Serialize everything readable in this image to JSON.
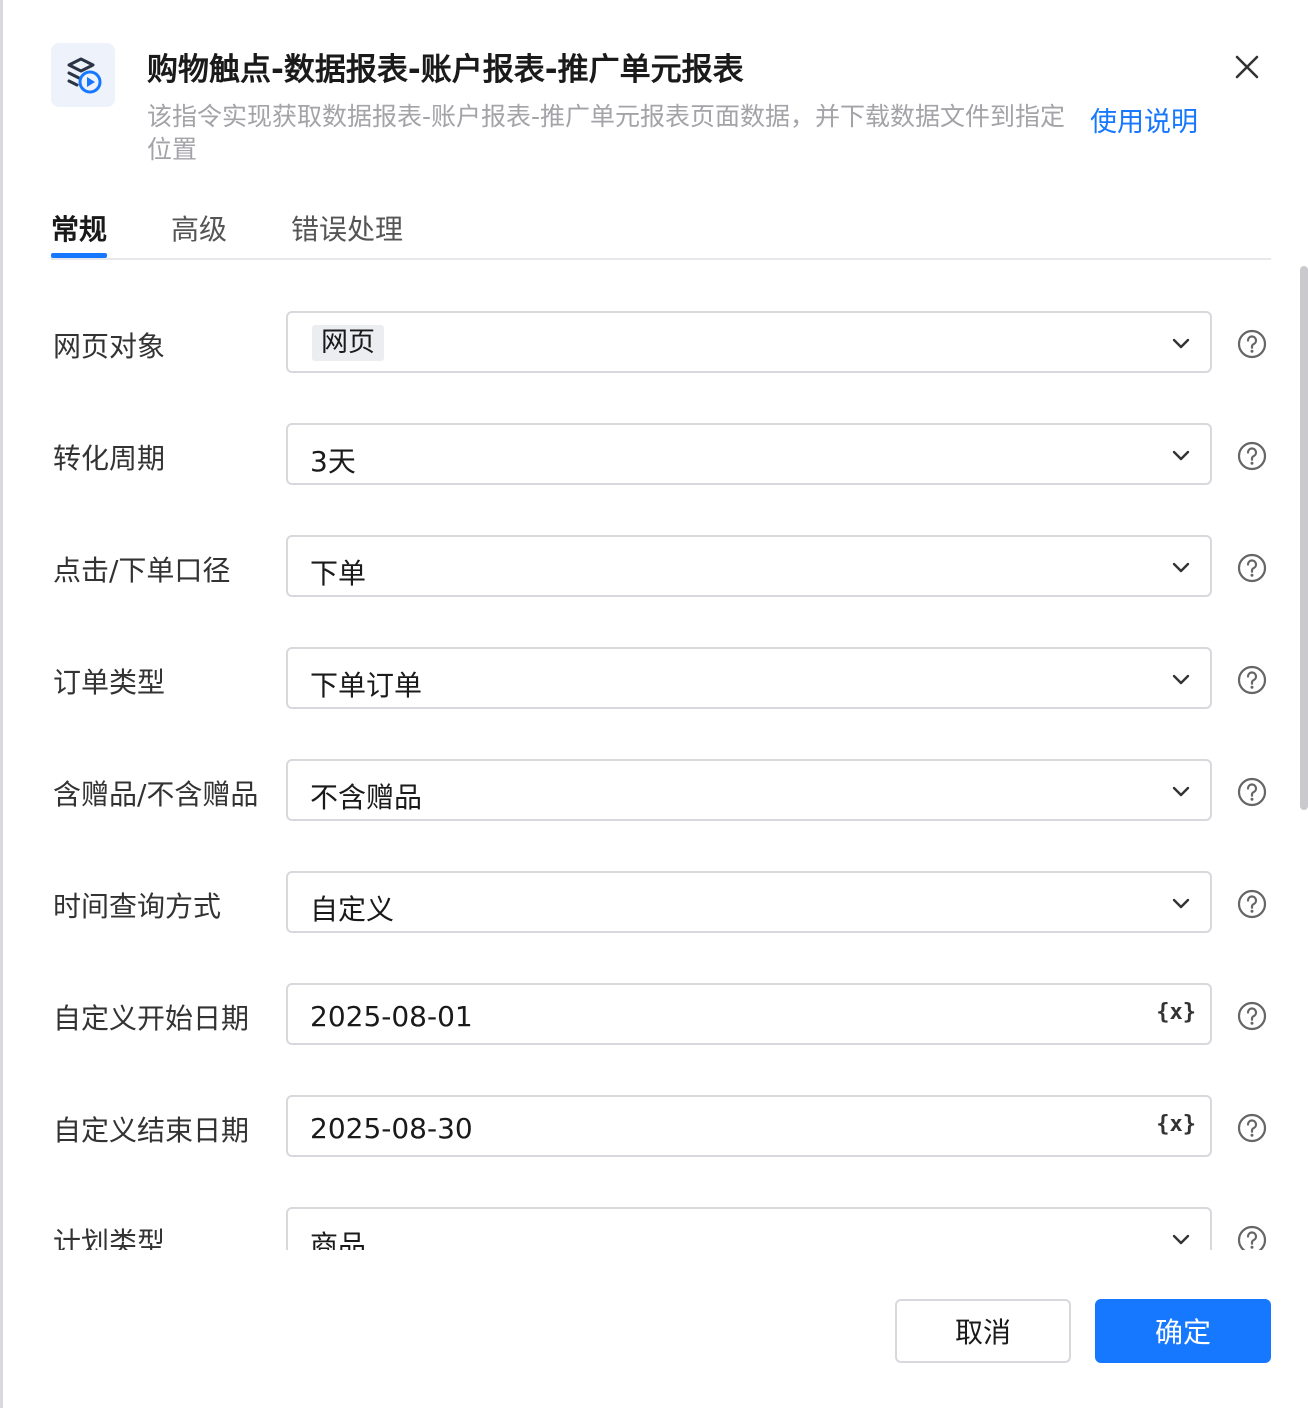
{
  "header": {
    "icon": "report-download-icon",
    "title": "购物触点-数据报表-账户报表-推广单元报表",
    "description": "该指令实现获取数据报表-账户报表-推广单元报表页面数据，并下载数据文件到指定位置",
    "help_link": "使用说明",
    "close_icon": "close-icon"
  },
  "tabs": [
    {
      "label": "常规",
      "active": true
    },
    {
      "label": "高级",
      "active": false
    },
    {
      "label": "错误处理",
      "active": false
    }
  ],
  "form": {
    "rows": [
      {
        "label": "网页对象",
        "value": "网页",
        "kind": "tag-select"
      },
      {
        "label": "转化周期",
        "value": "3天",
        "kind": "select"
      },
      {
        "label": "点击/下单口径",
        "value": "下单",
        "kind": "select"
      },
      {
        "label": "订单类型",
        "value": "下单订单",
        "kind": "select"
      },
      {
        "label": "含赠品/不含赠品",
        "value": "不含赠品",
        "kind": "select"
      },
      {
        "label": "时间查询方式",
        "value": "自定义",
        "kind": "select"
      },
      {
        "label": "自定义开始日期",
        "value": "2025-08-01",
        "kind": "variable-input"
      },
      {
        "label": "自定义结束日期",
        "value": "2025-08-30",
        "kind": "variable-input"
      },
      {
        "label": "计划类型",
        "value": "商品",
        "kind": "select"
      }
    ],
    "variable_icon_text": "{x}"
  },
  "footer": {
    "cancel_label": "取消",
    "ok_label": "确定"
  },
  "colors": {
    "accent": "#1677ff",
    "border": "#d9d9dd",
    "muted_text": "#a3a3a8"
  }
}
